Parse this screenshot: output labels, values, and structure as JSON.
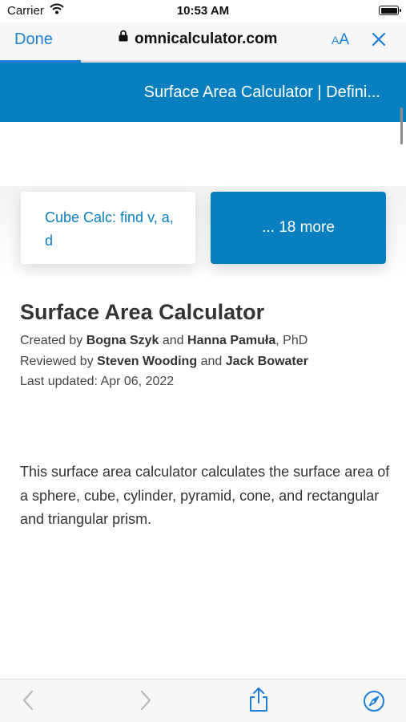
{
  "status_bar": {
    "carrier": "Carrier",
    "time": "10:53 AM"
  },
  "browser": {
    "done_label": "Done",
    "url": "omnicalculator.com",
    "text_size_small": "A",
    "text_size_large": "A",
    "load_progress": 0.2
  },
  "site_header": {
    "title": "Surface Area Calculator | Defini..."
  },
  "cards": {
    "left_label": "Cube Calc: find v, a, d",
    "right_label": "... 18 more"
  },
  "article": {
    "title": "Surface Area Calculator",
    "created_prefix": "Created by",
    "author_1": "Bogna Szyk",
    "and_1": "and",
    "author_2": "Hanna Pamuła",
    "author_2_suffix": ", PhD",
    "reviewed_prefix": "Reviewed by",
    "reviewer_1": "Steven Wooding",
    "and_2": "and",
    "reviewer_2": "Jack Bowater",
    "last_updated": "Last updated: Apr 06, 2022",
    "intro": "This surface area calculator calculates the surface area of a sphere, cube, cylinder, pyramid, cone, and rectangular and triangular prism."
  },
  "toolbar": {
    "icons": [
      "back-icon",
      "forward-icon",
      "share-icon",
      "safari-compass-icon"
    ]
  },
  "colors": {
    "accent_blue": "#1d7fd6",
    "brand_blue": "#0a7fbf"
  }
}
